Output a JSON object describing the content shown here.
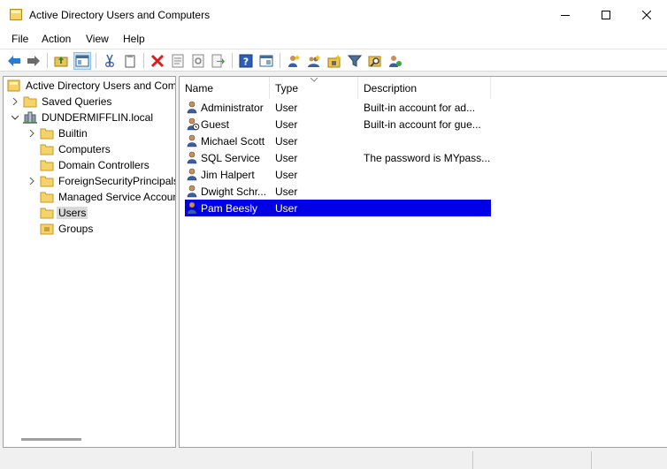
{
  "window": {
    "title": "Active Directory Users and Computers",
    "icons": {
      "app": "folder-icon",
      "minimize": "minimize-icon",
      "maximize": "maximize-icon",
      "close": "close-icon"
    }
  },
  "menu": {
    "items": [
      "File",
      "Action",
      "View",
      "Help"
    ]
  },
  "toolbar": {
    "buttons": [
      "back-arrow-icon",
      "forward-arrow-icon",
      "up-folder-icon",
      "console-tree-icon",
      "cut-icon",
      "copy-icon",
      "delete-icon",
      "properties-icon",
      "refresh-icon",
      "export-list-icon",
      "help-icon",
      "details-view-icon",
      "new-user-icon",
      "new-group-icon",
      "new-ou-icon",
      "filter-icon",
      "find-icon",
      "add-to-group-icon"
    ]
  },
  "tree": {
    "root": "Active Directory Users and Computers",
    "saved_queries": "Saved Queries",
    "domain": "DUNDERMIFFLIN.local",
    "children": [
      "Builtin",
      "Computers",
      "Domain Controllers",
      "ForeignSecurityPrincipals",
      "Managed Service Accounts",
      "Users",
      "Groups"
    ],
    "selected": "Users"
  },
  "list": {
    "columns": [
      "Name",
      "Type",
      "Description"
    ],
    "rows": [
      {
        "name": "Administrator",
        "type": "User",
        "description": "Built-in account for ad..."
      },
      {
        "name": "Guest",
        "type": "User",
        "description": "Built-in account for gue..."
      },
      {
        "name": "Michael Scott",
        "type": "User",
        "description": ""
      },
      {
        "name": "SQL Service",
        "type": "User",
        "description": "The password is MYpass..."
      },
      {
        "name": "Jim Halpert",
        "type": "User",
        "description": ""
      },
      {
        "name": "Dwight Schr...",
        "type": "User",
        "description": ""
      },
      {
        "name": "Pam Beesly",
        "type": "User",
        "description": ""
      }
    ],
    "selected_row": "Pam Beesly"
  },
  "colors": {
    "selection": "#0000e6",
    "tree_selection": "#d9d9d9",
    "accent": "#0067c0"
  }
}
